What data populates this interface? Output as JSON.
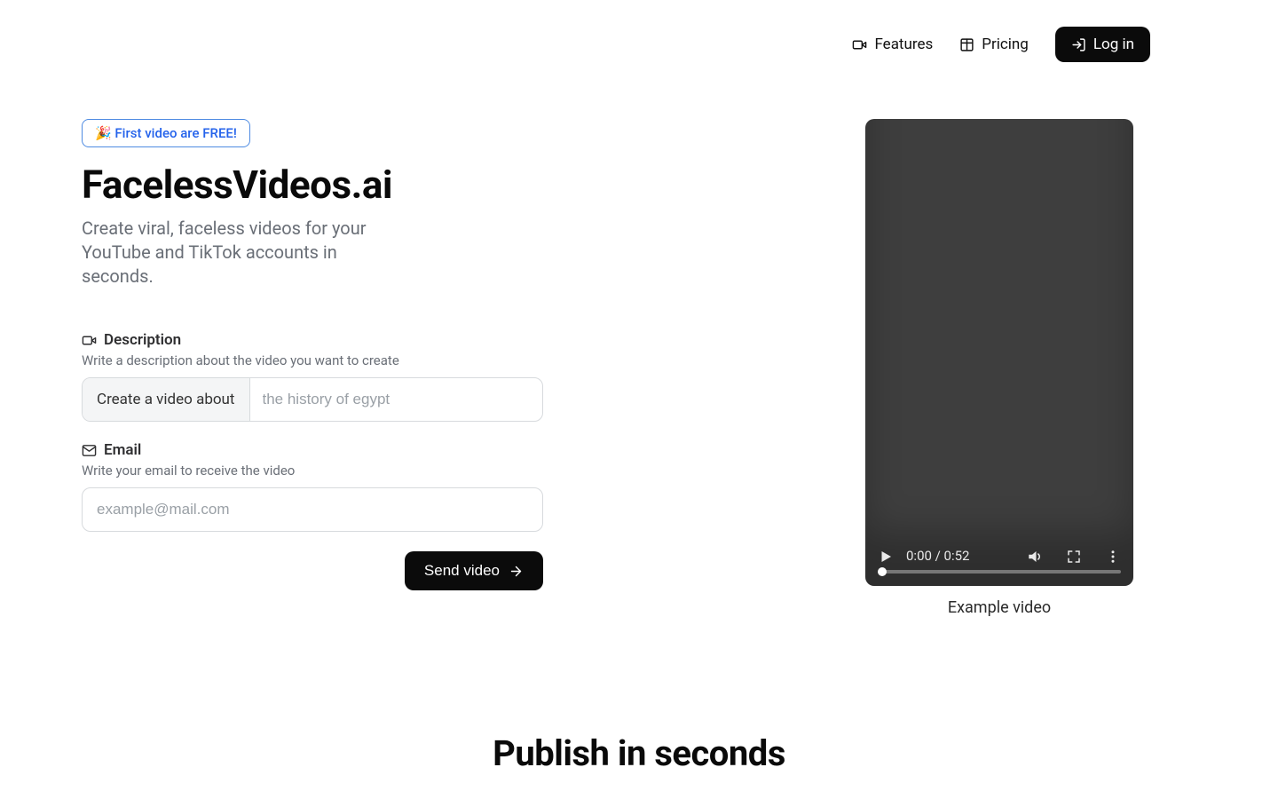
{
  "nav": {
    "features": "Features",
    "pricing": "Pricing",
    "login": "Log in"
  },
  "hero": {
    "badge": "🎉 First video are FREE!",
    "title": "FacelessVideos.ai",
    "subtitle": "Create viral, faceless videos for your YouTube and TikTok accounts in seconds."
  },
  "form": {
    "desc_label": "Description",
    "desc_hint": "Write a description about the video you want to create",
    "desc_addon": "Create a video about",
    "desc_placeholder": "the history of egypt",
    "email_label": "Email",
    "email_hint": "Write your email to receive the video",
    "email_placeholder": "example@mail.com",
    "submit": "Send video"
  },
  "video": {
    "time": "0:00 / 0:52",
    "caption": "Example video"
  },
  "section2_title": "Publish in seconds"
}
